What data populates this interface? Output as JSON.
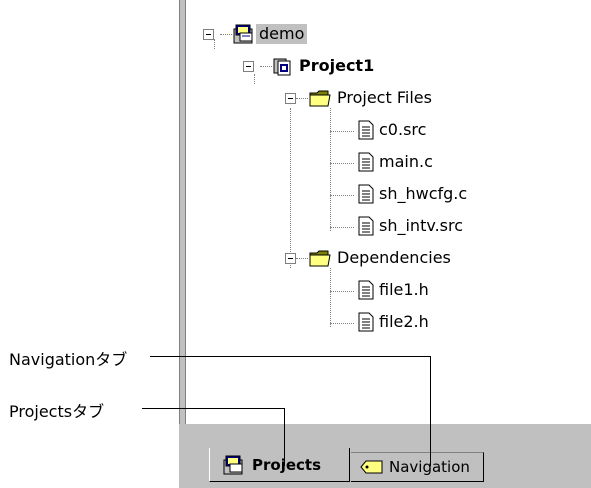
{
  "tree": {
    "root": {
      "label": "demo",
      "icon": "workspace-icon"
    },
    "project": {
      "label": "Project1",
      "icon": "project-icon"
    },
    "folders": [
      {
        "label": "Project Files",
        "icon": "folder-icon",
        "files": [
          "c0.src",
          "main.c",
          "sh_hwcfg.c",
          "sh_intv.src"
        ]
      },
      {
        "label": "Dependencies",
        "icon": "folder-icon",
        "files": [
          "file1.h",
          "file2.h"
        ]
      }
    ]
  },
  "tabs": [
    {
      "label": "Projects",
      "icon": "projects-tab-icon",
      "active": true
    },
    {
      "label": "Navigation",
      "icon": "navigation-tab-icon",
      "active": false
    }
  ],
  "callouts": {
    "navigation": "Navigationタブ",
    "projects": "Projectsタブ"
  },
  "colors": {
    "panel_gray": "#c0c0c0",
    "folder_yellow": "#ffff80",
    "folder_dark": "#808000",
    "project_blue": "#000080"
  }
}
